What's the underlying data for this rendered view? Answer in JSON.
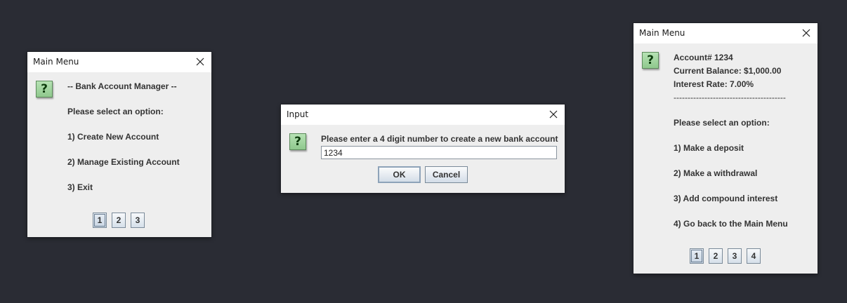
{
  "main_menu": {
    "title": "Main Menu",
    "lines": [
      "-- Bank Account Manager --",
      "Please select an option:",
      "1) Create New Account",
      "2) Manage Existing Account",
      "3) Exit"
    ],
    "options": [
      "1",
      "2",
      "3"
    ],
    "selected_option": "1"
  },
  "input_dialog": {
    "title": "Input",
    "prompt": "Please enter a 4 digit number to create a new bank account",
    "value": "1234",
    "ok_label": "OK",
    "cancel_label": "Cancel"
  },
  "account_menu": {
    "title": "Main Menu",
    "lines": [
      "Account# 1234",
      "Current Balance: $1,000.00",
      "Interest Rate: 7.00%",
      "----------------------------------------",
      "Please select an option:",
      "1) Make a deposit",
      "2) Make a withdrawal",
      "3) Add compound interest",
      "4) Go back to the Main Menu"
    ],
    "options": [
      "1",
      "2",
      "3",
      "4"
    ],
    "selected_option": "1"
  },
  "icons": {
    "question": "?"
  },
  "colors": {
    "desktop_bg": "#2a2c34",
    "dialog_bg": "#eeeeee",
    "titlebar_bg": "#ffffff",
    "question_icon": "#9fd49d"
  }
}
